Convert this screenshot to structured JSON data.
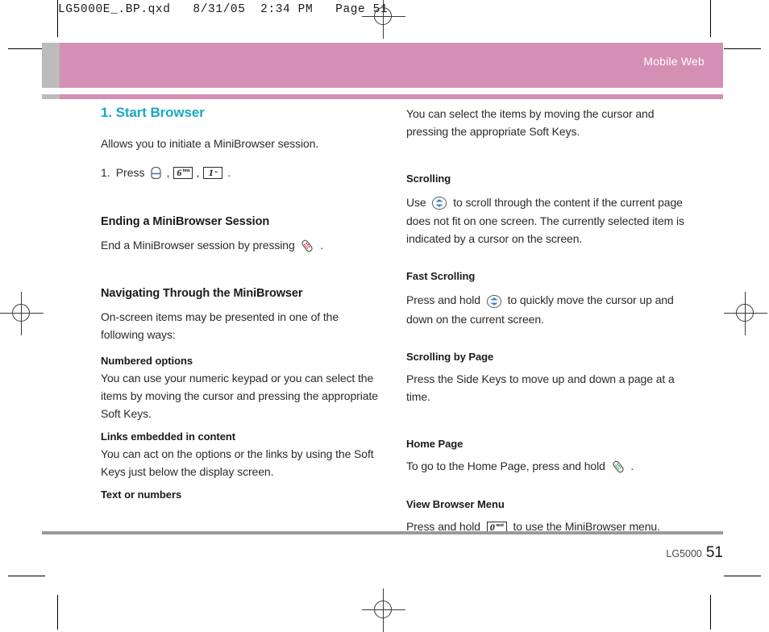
{
  "proof": {
    "slug": "LG5000E_.BP.qxd   8/31/05  2:34 PM   Page 51"
  },
  "header": {
    "band_title": "Mobile Web",
    "band_color": "#d48fb5",
    "tab_color": "#bcbcbc"
  },
  "footer": {
    "brand": "LG5000",
    "page_number": "51",
    "rule_color": "#9a9a9a"
  },
  "accent_color": "#17a9c4",
  "left_column": {
    "section_title": "1. Start Browser",
    "intro": "Allows you to initiate a MiniBrowser session.",
    "step": {
      "number": "1.",
      "verb": "Press",
      "keys": [
        "menu-ok-key",
        "6tmo-key",
        "1-key"
      ],
      "separator": ",",
      "terminator": "."
    },
    "ending_heading": "Ending a MiniBrowser Session",
    "ending_text_before": "End a MiniBrowser session by pressing",
    "ending_key": "end-key",
    "ending_text_after": ".",
    "navigating_heading": "Navigating Through the MiniBrowser",
    "navigating_text": "On-screen items may be presented in one of the following ways:",
    "numbered_heading": "Numbered options",
    "numbered_text": "You can use your numeric keypad or you can select the items by moving the cursor and pressing the appropriate Soft Keys.",
    "links_heading": "Links embedded in content",
    "links_text": "You can act on the options or the links by using the Soft Keys just below the display screen.",
    "text_numbers_heading": "Text or numbers"
  },
  "right_column": {
    "continued_text": "You can select the items by moving the cursor and pressing the appropriate Soft Keys.",
    "scrolling_heading": "Scrolling",
    "scrolling_text_before": "Use",
    "scrolling_key": "nav-wheel-key",
    "scrolling_text_after": "to scroll through the content if the current page does not fit on one screen. The currently selected item is indicated by a cursor on the screen.",
    "fast_scrolling_heading": "Fast Scrolling",
    "fast_scrolling_text_before": "Press and hold",
    "fast_scrolling_key": "nav-wheel-key",
    "fast_scrolling_text_after": "to quickly move the cursor up and down on the current screen.",
    "scrolling_by_page_heading": "Scrolling by Page",
    "scrolling_by_page_text": "Press the Side Keys to move up and down a page at a time.",
    "home_page_heading": "Home Page",
    "home_page_text_before": "To go to the Home Page, press and hold",
    "home_page_key": "send-key",
    "home_page_text_after": ".",
    "view_menu_heading": "View Browser Menu",
    "view_menu_text_before": "Press and hold",
    "view_menu_key": "0next-key",
    "view_menu_text_after": "to use the MiniBrowser menu."
  },
  "keys": {
    "six": {
      "digit": "6",
      "label": "tmo"
    },
    "one": {
      "digit": "1",
      "label": "••"
    },
    "zero": {
      "digit": "0",
      "label": "next"
    }
  }
}
